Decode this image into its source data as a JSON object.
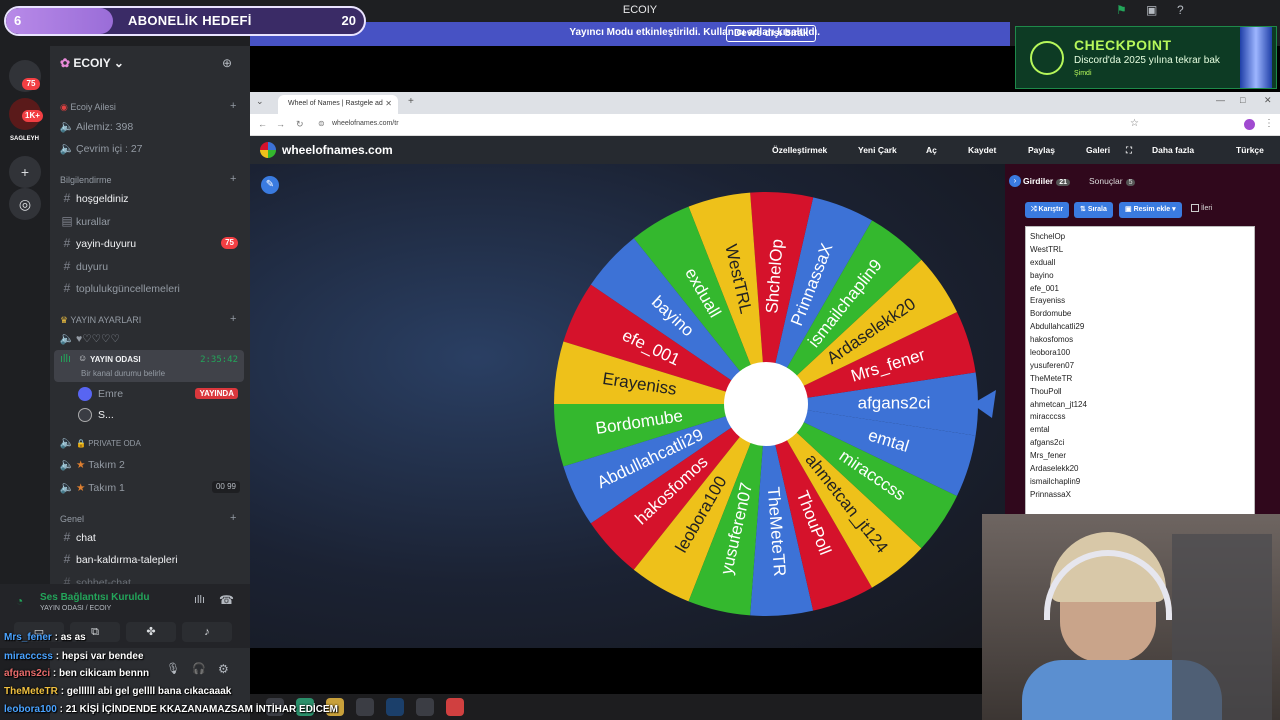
{
  "topbar": {
    "title": "ECOIY"
  },
  "goal": {
    "current": "6",
    "label": "ABONELİK HEDEFİ",
    "target": "20",
    "progress": 0.3
  },
  "notice": {
    "text": "Yayıncı Modu etkinleştirildi. Kullanıcı adları kısaltıldı.",
    "button": "Devre dışı bırak"
  },
  "rail": {
    "badges": [
      "75",
      "1K+"
    ],
    "server_label": "SAGLEYH"
  },
  "server": {
    "name": "ECOIY"
  },
  "channels": {
    "categories": [
      "Ecoiy Ailesi",
      "Bilgilendirme",
      "YAYIN AYARLARI",
      "Genel"
    ],
    "family_stats": [
      "Ailemiz: 398",
      "Çevrim içi : 27"
    ],
    "info": [
      "hoşgeldiniz",
      "kurallar",
      "yayin-duyuru",
      "duyuru",
      "toplulukgüncellemeleri"
    ],
    "yayin_duyuru_badge": "75",
    "settings_voice": "♥♡♡♡♡",
    "active_voice": {
      "name": "YAYIN ODASI",
      "time": "2:35:42",
      "status": "Bir kanal durumu belirle"
    },
    "members": [
      {
        "name": "Emre",
        "tag": "YAYINDA"
      },
      {
        "name": "S..."
      }
    ],
    "private": "PRIVATE ODA",
    "teams": [
      {
        "name": "Takım 2"
      },
      {
        "name": "Takım 1",
        "count": "00 99"
      }
    ],
    "general": [
      "chat",
      "ban-kaldırma-talepleri",
      "sohbet-chat"
    ]
  },
  "voice_panel": {
    "status": "Ses Bağlantısı Kuruldu",
    "sub": "YAYIN ODASI / ECOIY"
  },
  "chat": [
    {
      "user": "Mrs_fener",
      "text": ": as as"
    },
    {
      "user": "miracccss",
      "text": ": hepsi var bendee"
    },
    {
      "user": "afgans2ci",
      "text": ": ben cikicam bennn"
    },
    {
      "user": "TheMeteTR",
      "text": ": gellllll abi gel gellll bana cıkacaaak"
    },
    {
      "user": "leobora100",
      "text": ": 21 KİŞİ İÇİNDENDE KKAZANAMAZSAM İNTİHAR EDİCEM"
    }
  ],
  "sponsor": {
    "title": "CHECKPOINT",
    "line": "Discord'da 2025 yılına tekrar bak",
    "small": "Şimdi"
  },
  "browser": {
    "tab_title": "Wheel of Names | Rastgele ad",
    "url": "wheelofnames.com/tr",
    "brand": "wheelofnames.com",
    "nav": [
      "Özelleştirmek",
      "Yeni Çark",
      "Aç",
      "Kaydet",
      "Paylaş",
      "Galeri",
      "Daha fazla",
      "Türkçe"
    ]
  },
  "panel": {
    "tab_entries": "Girdiler",
    "entries_count": "21",
    "tab_results": "Sonuçlar",
    "results_count": "5",
    "buttons": [
      "Karıştır",
      "Sırala",
      "Resim ekle",
      "İleri"
    ]
  },
  "wheel": {
    "colors": {
      "yellow": "#eec11a",
      "red": "#d5122b",
      "green": "#34b82e",
      "blue": "#3d72d6"
    },
    "entries": [
      "afgans2ci",
      "Mrs_fener",
      "Ardaselekk20",
      "ismailchaplin9",
      "PrinnassaX",
      "ShchelOp",
      "WestTRL",
      "exduall",
      "bayino",
      "efe_001",
      "Erayeniss",
      "Bordomube",
      "Abdullahcatli29",
      "hakosfomos",
      "leobora100",
      "yusuferen07",
      "TheMeteTR",
      "ThouPoll",
      "ahmetcan_jt124",
      "miracccss",
      "emtal"
    ]
  },
  "entry_list": [
    "ShchelOp",
    "WestTRL",
    "exduall",
    "bayino",
    "efe_001",
    "Erayeniss",
    "Bordomube",
    "Abdullahcatli29",
    "hakosfomos",
    "leobora100",
    "yusuferen07",
    "TheMeteTR",
    "ThouPoll",
    "ahmetcan_jt124",
    "miracccss",
    "emtal",
    "afgans2ci",
    "Mrs_fener",
    "Ardaselekk20",
    "ismailchaplin9",
    "PrinnassaX"
  ]
}
